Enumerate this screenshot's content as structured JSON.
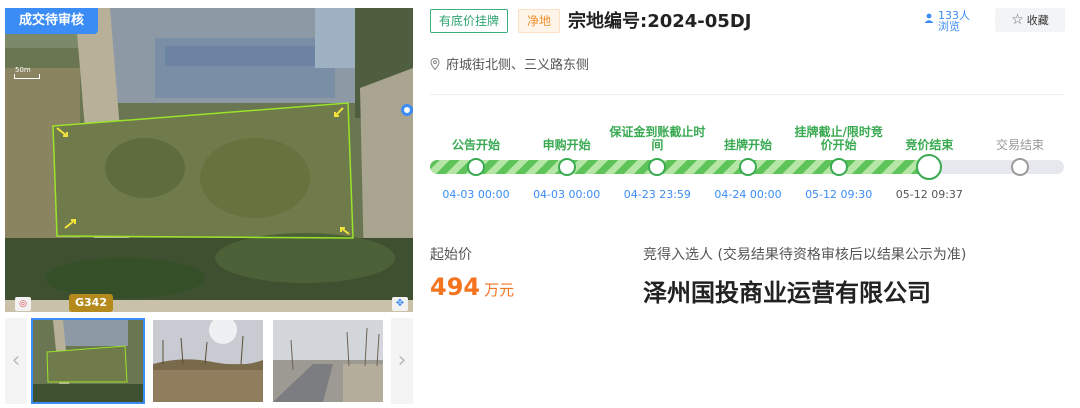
{
  "map": {
    "status_tag": "成交待审核",
    "scale_label": "50m",
    "road_tag": "G342",
    "colors": {
      "status_tag": "#3b8cf5",
      "boundary": "#9be32a",
      "road_tag": "#b58a1c"
    }
  },
  "gallery": {
    "thumbnails": [
      {
        "name": "parcel-map-thumbnail",
        "active": true
      },
      {
        "name": "site-photo-1",
        "active": false
      },
      {
        "name": "site-photo-2",
        "active": false
      }
    ],
    "prev_icon": "chevron-left-icon",
    "next_icon": "chevron-right-icon"
  },
  "header": {
    "tag_reserve": "有底价挂牌",
    "tag_net": "净地",
    "title": "宗地编号:2024-05DJ",
    "views": "133人浏览",
    "favorite_label": "收藏",
    "favorite_icon": "star-outline-icon",
    "views_icon": "user-icon"
  },
  "location": {
    "icon": "location-pin-icon",
    "text": "府城街北侧、三义路东侧"
  },
  "timeline": {
    "progress": 0.79,
    "steps": [
      {
        "label": "公告开始",
        "time": "04-03 00:00",
        "state": "done"
      },
      {
        "label": "申购开始",
        "time": "04-03 00:00",
        "state": "done"
      },
      {
        "label": "保证金到账截止时间",
        "time": "04-23 23:59",
        "state": "done"
      },
      {
        "label": "挂牌开始",
        "time": "04-24 00:00",
        "state": "done"
      },
      {
        "label": "挂牌截止/限时竞价开始",
        "time": "05-12 09:30",
        "state": "done"
      },
      {
        "label": "竞价结束",
        "time": "05-12 09:37",
        "state": "current"
      },
      {
        "label": "交易结束",
        "time": "",
        "state": "pending"
      }
    ],
    "colors": {
      "done": "#3aaa52",
      "time": "#3b8cf5",
      "pending": "#999999"
    }
  },
  "result": {
    "start_price_label": "起始价",
    "start_price_value": "494",
    "start_price_unit": "万元",
    "winner_label": "竞得入选人 (交易结果待资格审核后以结果公示为准)",
    "winner_name": "泽州国投商业运营有限公司",
    "colors": {
      "price": "#f5741f"
    }
  }
}
